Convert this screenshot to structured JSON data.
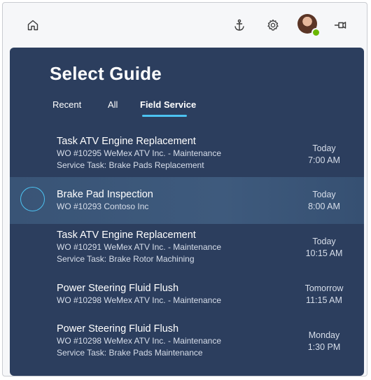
{
  "toolbar": {
    "icons": [
      "home-icon",
      "anchor-icon",
      "gear-icon",
      "avatar",
      "pin-icon"
    ],
    "presence_color": "#6bb700"
  },
  "panel": {
    "title": "Select Guide",
    "accent_color": "#4cc2f1",
    "background_color": "#2c3e5e"
  },
  "tabs": [
    {
      "label": "Recent",
      "active": false
    },
    {
      "label": "All",
      "active": false
    },
    {
      "label": "Field Service",
      "active": true
    }
  ],
  "guides": [
    {
      "title": "Task ATV Engine Replacement",
      "line1": "WO #10295  WeMex ATV Inc. - Maintenance",
      "line2": "Service Task: Brake Pads Replacement",
      "day": "Today",
      "time": "7:00 AM",
      "selected": false
    },
    {
      "title": "Brake Pad Inspection",
      "line1": "WO #10293  Contoso Inc",
      "line2": "",
      "day": "Today",
      "time": "8:00 AM",
      "selected": true
    },
    {
      "title": "Task ATV Engine Replacement",
      "line1": "WO #10291  WeMex ATV Inc. - Maintenance",
      "line2": "Service Task: Brake Rotor Machining",
      "day": "Today",
      "time": "10:15 AM",
      "selected": false
    },
    {
      "title": "Power Steering Fluid Flush",
      "line1": "WO #10298  WeMex ATV Inc. - Maintenance",
      "line2": "",
      "day": "Tomorrow",
      "time": "11:15 AM",
      "selected": false
    },
    {
      "title": "Power Steering Fluid Flush",
      "line1": "WO #10298  WeMex ATV Inc. - Maintenance",
      "line2": "Service Task: Brake Pads Maintenance",
      "day": "Monday",
      "time": "1:30 PM",
      "selected": false
    }
  ]
}
